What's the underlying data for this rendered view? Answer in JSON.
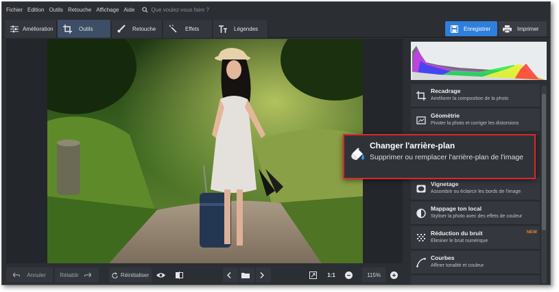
{
  "menu": {
    "items": [
      "Fichier",
      "Edition",
      "Outils",
      "Retouche",
      "Affichage",
      "Aide"
    ],
    "search_placeholder": "Que voulez-vous faire ?"
  },
  "toolbar": {
    "tabs": [
      {
        "label": "Amélioration",
        "icon": "sliders-icon"
      },
      {
        "label": "Outils",
        "icon": "crop-icon",
        "active": true
      },
      {
        "label": "Retouche",
        "icon": "brush-icon"
      },
      {
        "label": "Effets",
        "icon": "magic-wand-icon"
      },
      {
        "label": "Légendes",
        "icon": "text-icon"
      }
    ],
    "save_label": "Enregistrer",
    "print_label": "Imprimer"
  },
  "bottom": {
    "undo_label": "Annuler",
    "redo_label": "Rétablir",
    "reset_label": "Réinitialiser",
    "ratio_label": "1:1",
    "zoom_value": "115%"
  },
  "tools": [
    {
      "title": "Recadrage",
      "desc": "Améliorer la composition de la photo",
      "icon": "crop-icon"
    },
    {
      "title": "Géométrie",
      "desc": "Pivoter la photo et corriger les distorsions",
      "icon": "geometry-icon"
    },
    {
      "title": "Vignetage",
      "desc": "Assombrir ou éclaircir les bords de l'image",
      "icon": "vignette-icon"
    },
    {
      "title": "Mappage ton local",
      "desc": "Styliser la photo avec des effets de couleur",
      "icon": "tone-map-icon"
    },
    {
      "title": "Réduction du bruit",
      "desc": "Éliminer le bruit numérique",
      "icon": "noise-icon",
      "badge": "NEW"
    },
    {
      "title": "Courbes",
      "desc": "Affiner tonalité et couleur",
      "icon": "curves-icon"
    }
  ],
  "callout": {
    "title": "Changer l'arrière-plan",
    "desc": "Supprimer ou remplacer l'arrière-plan de l'image",
    "icon": "paint-bucket-icon",
    "border_color": "#e0262a"
  },
  "colors": {
    "accent": "#2f7fdc",
    "active_tab": "#3d4e66",
    "new_badge": "#e8812c"
  }
}
